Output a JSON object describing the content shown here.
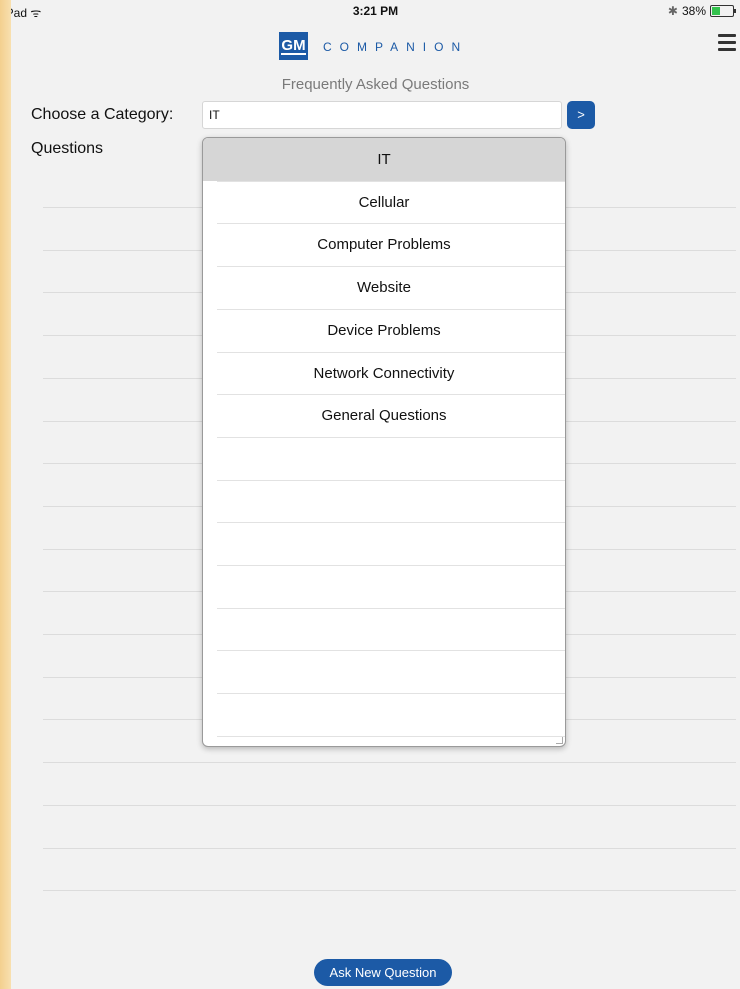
{
  "status_bar": {
    "device": "iPad",
    "wifi": "ᯤ",
    "time": "3:21 PM",
    "bluetooth": "✱",
    "battery": "38%",
    "battery_level": 0.38
  },
  "header": {
    "logo_text": "GM",
    "brand": "COMPANION"
  },
  "page_title": "Frequently Asked Questions",
  "category": {
    "label": "Choose a Category:",
    "value": "IT",
    "go_label": ">"
  },
  "questions_label": "Questions",
  "dropdown": {
    "selected_index": 0,
    "options": [
      "IT",
      "Cellular",
      "Computer Problems",
      "Website",
      "Device Problems",
      "Network Connectivity",
      "General Questions"
    ],
    "empty_rows": 7
  },
  "background_rows": 17,
  "ask_button": "Ask New Question"
}
